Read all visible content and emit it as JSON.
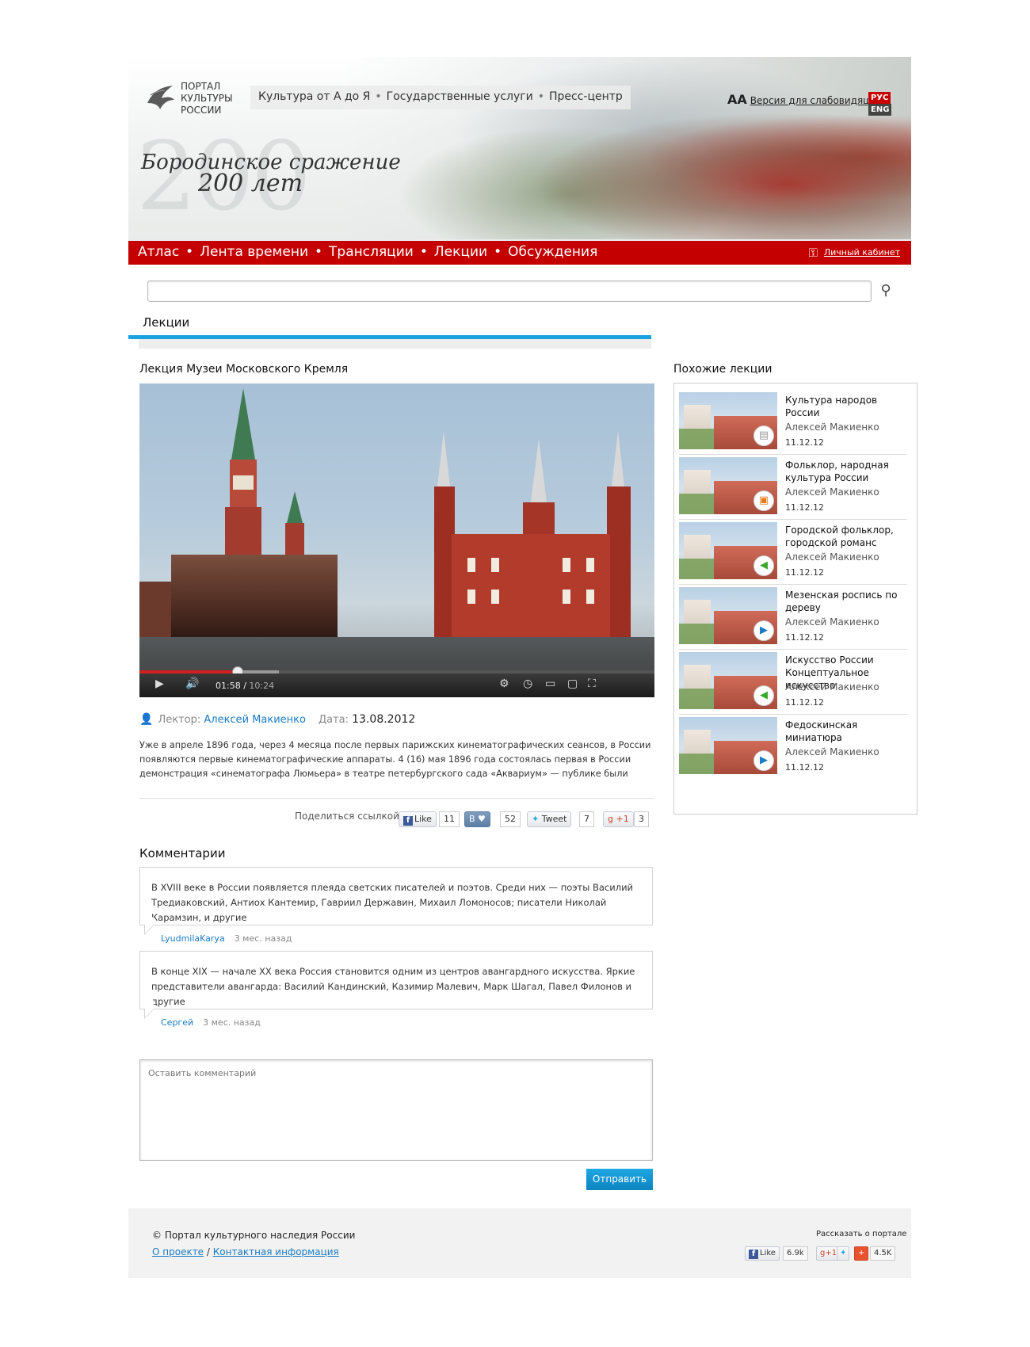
{
  "brand": {
    "logo_line1": "ПОРТАЛ",
    "logo_line2": "КУЛЬТУРЫ",
    "logo_line3": "РОССИИ"
  },
  "top_nav": {
    "item1": "Культура от А до Я",
    "item2": "Государственные услуги",
    "item3": "Пресс-центр"
  },
  "accessibility": {
    "icon_label": "AA",
    "label": "Версия для слабовидящих"
  },
  "language": {
    "ru": "РУС",
    "en": "ENG",
    "active": "ru"
  },
  "banner": {
    "line1": "Бородинское сражение",
    "line2": "200 лет",
    "ghost_number": "200"
  },
  "main_nav": {
    "items": [
      "Атлас",
      "Лента времени",
      "Трансляции",
      "Лекции",
      "Обсуждения"
    ],
    "cabinet": "Личный кабинет"
  },
  "search": {
    "value": "",
    "button_icon": "search-icon"
  },
  "section": {
    "title": "Лекции"
  },
  "lecture": {
    "title": "Лекция Музеи Московского Кремля",
    "video": {
      "current_time": "01:58",
      "duration": "10:24",
      "played_fraction": 0.19,
      "buffered_fraction": 0.27
    },
    "lecturer_label": "Лектор:",
    "lecturer_name": "Алексей Макиенко",
    "date_label": "Дата:",
    "date": "13.08.2012",
    "description": "Уже в апреле 1896 года, через 4 месяца после первых парижских кинематографических сеансов, в России появляются первые кинематографические аппараты. 4 (16) мая 1896 года состоялась первая в России демонстрация «синематографа Люмьера» в театре петербургского сада «Аквариум» — публике были показаны несколько о фильмов в"
  },
  "share": {
    "label": "Поделиться ссылкой:",
    "fb_label": "Like",
    "fb_count": "11",
    "vk_label": "В ♥",
    "vk_count": "52",
    "tw_label": "Tweet",
    "tw_count": "7",
    "gp_label": "+1",
    "gp_count": "3"
  },
  "comments": {
    "title": "Комментарии",
    "items": [
      {
        "text": "В XVIII веке в России появляется плеяда светских писателей и поэтов. Среди них — поэты Василий Тредиаковский, Антиох Кантемир, Гавриил Державин, Михаил Ломоносов; писатели Николай Карамзин, и другие",
        "author": "LyudmilaKarya",
        "time": "3 мес. назад"
      },
      {
        "text": "В конце XIX — начале XX века Россия становится одним из центров авангардного искусства. Яркие представители  авангарда: Василий Кандинский, Казимир Малевич, Марк Шагал, Павел Филонов и другие",
        "author": "Сергей",
        "time": "3 мес. назад"
      }
    ],
    "input_placeholder": "Оставить комментарий",
    "submit_label": "Отправить"
  },
  "similar": {
    "title": "Похожие лекции",
    "items": [
      {
        "title": "Культура народов России",
        "author": "Алексей Макиенко",
        "date": "11.12.12",
        "badge": "presentation-icon",
        "badge_color": "#9a9a9a"
      },
      {
        "title": "Фольклор, народная культура России",
        "author": "Алексей Макиенко",
        "date": "11.12.12",
        "badge": "slides-icon",
        "badge_color": "#e07a1a"
      },
      {
        "title": "Городской фольклор, городской романс",
        "author": "Алексей Макиенко",
        "date": "11.12.12",
        "badge": "audio-icon",
        "badge_color": "#3aa82a"
      },
      {
        "title": "Мезенская роспись по дереву",
        "author": "Алексей Макиенко",
        "date": "11.12.12",
        "badge": "video-icon",
        "badge_color": "#1a7bc4"
      },
      {
        "title": "Искусство России Концептуальное искусство",
        "author": "Алексей Макиенко",
        "date": "11.12.12",
        "badge": "audio-icon",
        "badge_color": "#3aa82a"
      },
      {
        "title": "Федоскинская миниатюра",
        "author": "Алексей Макиенко",
        "date": "11.12.12",
        "badge": "video-icon",
        "badge_color": "#1a7bc4"
      }
    ]
  },
  "footer": {
    "copyright": "© Портал культурного наследия России",
    "about_link": "О проекте",
    "slash": "/",
    "contacts_link": "Контактная информация",
    "tell_label": "Рассказать о портале",
    "fb_label": "Like",
    "fb_count": "6.9k",
    "gp_label": "+1",
    "share_count": "4.5K"
  },
  "colors": {
    "accent_red": "#c40000",
    "accent_blue": "#16a3e0",
    "link": "#1a7bc4"
  }
}
